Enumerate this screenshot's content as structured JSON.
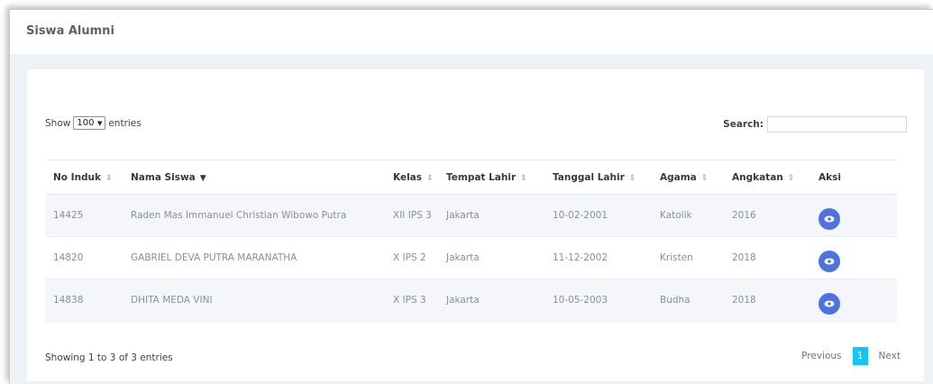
{
  "header": {
    "title": "Siswa Alumni"
  },
  "controls": {
    "show_label": "Show",
    "entries_value": "100",
    "entries_label": "entries",
    "search_label": "Search:",
    "search_value": ""
  },
  "table": {
    "columns": [
      "No Induk",
      "Nama Siswa",
      "Kelas",
      "Tempat Lahir",
      "Tanggal Lahir",
      "Agama",
      "Angkatan",
      "Aksi"
    ],
    "rows": [
      [
        "14425",
        "Raden Mas Immanuel Christian Wibowo Putra",
        "XII IPS 3",
        "Jakarta",
        "10-02-2001",
        "Katolik",
        "2016"
      ],
      [
        "14820",
        "GABRIEL DEVA PUTRA MARANATHA",
        "X IPS 2",
        "Jakarta",
        "11-12-2002",
        "Kristen",
        "2018"
      ],
      [
        "14838",
        "DHITA MEDA VINI",
        "X IPS 3",
        "Jakarta",
        "10-05-2003",
        "Budha",
        "2018"
      ]
    ]
  },
  "footer": {
    "info": "Showing 1 to 3 of 3 entries",
    "previous": "Previous",
    "page": "1",
    "next": "Next"
  },
  "colors": {
    "accent": "#4e73df",
    "page_active": "#13c5f4"
  },
  "icons": {
    "row_action": "eye-icon"
  }
}
